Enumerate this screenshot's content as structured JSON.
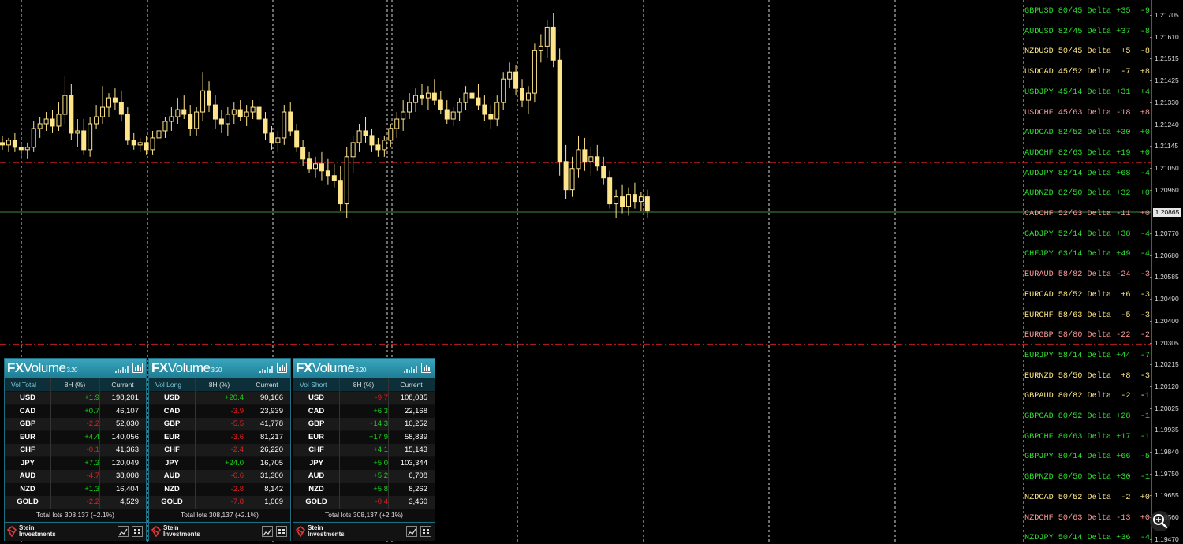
{
  "colors": {
    "green": "#2ee02e",
    "red": "#ff9a9a",
    "yellow": "#ffe680",
    "candle": "#ffe58a",
    "grid": "#ffffff",
    "level_line": "#c02020",
    "current_line": "#3f8a3f",
    "panel_header": "#2a94ab"
  },
  "pairs": [
    {
      "text": "GBPUSD 80/45 Delta +35  -9",
      "color": "green"
    },
    {
      "text": "AUDUSD 82/45 Delta +37  -8",
      "color": "green"
    },
    {
      "text": "NZDUSD 50/45 Delta  +5  -8",
      "color": "yellow"
    },
    {
      "text": "USDCAD 45/52 Delta  -7  +8",
      "color": "yellow"
    },
    {
      "text": "USDJPY 45/14 Delta +31  +4",
      "color": "green"
    },
    {
      "text": "USDCHF 45/63 Delta -18  +8",
      "color": "red"
    },
    {
      "text": "AUDCAD 82/52 Delta +30  +0",
      "color": "green"
    },
    {
      "text": "AUDCHF 82/63 Delta +19  +0",
      "color": "green"
    },
    {
      "text": "AUDJPY 82/14 Delta +68  -4",
      "color": "green"
    },
    {
      "text": "AUDNZD 82/50 Delta +32  +0",
      "color": "green"
    },
    {
      "text": "CADCHF 52/63 Delta -11  +0",
      "color": "red"
    },
    {
      "text": "CADJPY 52/14 Delta +38  -4",
      "color": "green"
    },
    {
      "text": "CHFJPY 63/14 Delta +49  -4",
      "color": "green"
    },
    {
      "text": "EURAUD 58/82 Delta -24  -3",
      "color": "red"
    },
    {
      "text": "EURCAD 58/52 Delta  +6  -3",
      "color": "yellow"
    },
    {
      "text": "EURCHF 58/63 Delta  -5  -3",
      "color": "yellow"
    },
    {
      "text": "EURGBP 58/80 Delta -22  -2",
      "color": "red"
    },
    {
      "text": "EURJPY 58/14 Delta +44  -7",
      "color": "green"
    },
    {
      "text": "EURNZD 58/50 Delta  +8  -3",
      "color": "yellow"
    },
    {
      "text": "GBPAUD 80/82 Delta  -2  -1",
      "color": "yellow"
    },
    {
      "text": "GBPCAD 80/52 Delta +28  -1",
      "color": "green"
    },
    {
      "text": "GBPCHF 80/63 Delta +17  -1",
      "color": "green"
    },
    {
      "text": "GBPJPY 80/14 Delta +66  -5",
      "color": "green"
    },
    {
      "text": "GBPNZD 80/50 Delta +30  -1",
      "color": "green"
    },
    {
      "text": "NZDCAD 50/52 Delta  -2  +0",
      "color": "yellow"
    },
    {
      "text": "NZDCHF 50/63 Delta -13  +0",
      "color": "red"
    },
    {
      "text": "NZDJPY 50/14 Delta +36  -4",
      "color": "green"
    }
  ],
  "price_axis": {
    "labels": [
      "1.21705",
      "1.21610",
      "1.21515",
      "1.21425",
      "1.21330",
      "1.21240",
      "1.21145",
      "1.21050",
      "1.20960",
      "1.20865",
      "1.20770",
      "1.20680",
      "1.20585",
      "1.20490",
      "1.20400",
      "1.20305",
      "1.20215",
      "1.20120",
      "1.20025",
      "1.19935",
      "1.19840",
      "1.19750",
      "1.19655",
      "1.19560",
      "1.19470"
    ],
    "current": "1.20865"
  },
  "chart": {
    "price_top": 1.21705,
    "price_bottom": 1.1947,
    "current_price": 1.20865,
    "level_upper": 1.21075,
    "level_lower": 1.20305,
    "candles": [
      [
        1.2116,
        1.2119,
        1.2113,
        1.2115
      ],
      [
        1.2115,
        1.2118,
        1.2112,
        1.2117
      ],
      [
        1.2117,
        1.212,
        1.2112,
        1.2114
      ],
      [
        1.2114,
        1.2116,
        1.2109,
        1.2113
      ],
      [
        1.2113,
        1.2116,
        1.2109,
        1.2114
      ],
      [
        1.2114,
        1.2125,
        1.2112,
        1.2122
      ],
      [
        1.2122,
        1.2127,
        1.2118,
        1.2124
      ],
      [
        1.2124,
        1.2129,
        1.2121,
        1.2126
      ],
      [
        1.2126,
        1.213,
        1.212,
        1.2123
      ],
      [
        1.2123,
        1.2133,
        1.2121,
        1.2128
      ],
      [
        1.2128,
        1.2144,
        1.2124,
        1.2136
      ],
      [
        1.2136,
        1.2141,
        1.2117,
        1.212
      ],
      [
        1.212,
        1.2126,
        1.2114,
        1.2121
      ],
      [
        1.2121,
        1.2126,
        1.2111,
        1.2113
      ],
      [
        1.2113,
        1.2127,
        1.211,
        1.2124
      ],
      [
        1.2124,
        1.2132,
        1.2122,
        1.2127
      ],
      [
        1.2127,
        1.214,
        1.2124,
        1.2131
      ],
      [
        1.2131,
        1.2137,
        1.2127,
        1.2135
      ],
      [
        1.2135,
        1.2139,
        1.213,
        1.2133
      ],
      [
        1.2133,
        1.2138,
        1.2125,
        1.2128
      ],
      [
        1.2128,
        1.2131,
        1.2115,
        1.2117
      ],
      [
        1.2117,
        1.212,
        1.2113,
        1.2115
      ],
      [
        1.2115,
        1.2118,
        1.2112,
        1.2116
      ],
      [
        1.2116,
        1.2119,
        1.2111,
        1.2113
      ],
      [
        1.2113,
        1.2121,
        1.2111,
        1.2118
      ],
      [
        1.2118,
        1.2124,
        1.2115,
        1.2121
      ],
      [
        1.2121,
        1.2127,
        1.2118,
        1.2125
      ],
      [
        1.2125,
        1.2131,
        1.2121,
        1.2127
      ],
      [
        1.2127,
        1.2135,
        1.2124,
        1.213
      ],
      [
        1.213,
        1.2136,
        1.2126,
        1.2128
      ],
      [
        1.2128,
        1.2132,
        1.2119,
        1.2122
      ],
      [
        1.2122,
        1.2131,
        1.2119,
        1.2129
      ],
      [
        1.2129,
        1.2146,
        1.2125,
        1.2138
      ],
      [
        1.2138,
        1.2142,
        1.2129,
        1.2132
      ],
      [
        1.2132,
        1.2136,
        1.2122,
        1.2126
      ],
      [
        1.2126,
        1.213,
        1.212,
        1.2124
      ],
      [
        1.2124,
        1.2131,
        1.2119,
        1.2128
      ],
      [
        1.2128,
        1.2133,
        1.2124,
        1.213
      ],
      [
        1.213,
        1.2134,
        1.2125,
        1.2127
      ],
      [
        1.2127,
        1.2132,
        1.2123,
        1.2129
      ],
      [
        1.2129,
        1.2134,
        1.2126,
        1.2131
      ],
      [
        1.2131,
        1.2135,
        1.2124,
        1.2126
      ],
      [
        1.2126,
        1.2129,
        1.2117,
        1.212
      ],
      [
        1.212,
        1.2123,
        1.2113,
        1.2116
      ],
      [
        1.2116,
        1.2121,
        1.2112,
        1.2118
      ],
      [
        1.2118,
        1.2132,
        1.2115,
        1.2129
      ],
      [
        1.2129,
        1.2133,
        1.2119,
        1.2121
      ],
      [
        1.2121,
        1.2124,
        1.2112,
        1.2114
      ],
      [
        1.2114,
        1.2117,
        1.2106,
        1.2109
      ],
      [
        1.2109,
        1.2112,
        1.2103,
        1.2105
      ],
      [
        1.2105,
        1.211,
        1.2101,
        1.2107
      ],
      [
        1.2107,
        1.2112,
        1.21,
        1.2104
      ],
      [
        1.2104,
        1.2109,
        1.2098,
        1.2102
      ],
      [
        1.2102,
        1.2107,
        1.2097,
        1.21
      ],
      [
        1.21,
        1.2106,
        1.2087,
        1.209
      ],
      [
        1.209,
        1.2114,
        1.2084,
        1.211
      ],
      [
        1.211,
        1.2119,
        1.2103,
        1.2116
      ],
      [
        1.2116,
        1.2124,
        1.2112,
        1.2121
      ],
      [
        1.2121,
        1.2127,
        1.2116,
        1.2119
      ],
      [
        1.2119,
        1.2122,
        1.2112,
        1.2115
      ],
      [
        1.2115,
        1.2118,
        1.211,
        1.2113
      ],
      [
        1.2113,
        1.2119,
        1.211,
        1.2117
      ],
      [
        1.2117,
        1.2124,
        1.2114,
        1.2122
      ],
      [
        1.2122,
        1.2129,
        1.2118,
        1.2126
      ],
      [
        1.2126,
        1.2134,
        1.2121,
        1.2129
      ],
      [
        1.2129,
        1.2137,
        1.2126,
        1.2133
      ],
      [
        1.2133,
        1.2139,
        1.2129,
        1.2136
      ],
      [
        1.2136,
        1.2141,
        1.2132,
        1.2135
      ],
      [
        1.2135,
        1.214,
        1.213,
        1.2137
      ],
      [
        1.2137,
        1.2143,
        1.2132,
        1.2134
      ],
      [
        1.2134,
        1.2138,
        1.2128,
        1.213
      ],
      [
        1.213,
        1.2134,
        1.2124,
        1.2126
      ],
      [
        1.2126,
        1.2131,
        1.2123,
        1.2129
      ],
      [
        1.2129,
        1.2135,
        1.2125,
        1.2133
      ],
      [
        1.2133,
        1.214,
        1.213,
        1.2137
      ],
      [
        1.2137,
        1.2143,
        1.2132,
        1.2135
      ],
      [
        1.2135,
        1.2141,
        1.213,
        1.2132
      ],
      [
        1.2132,
        1.2136,
        1.2125,
        1.2128
      ],
      [
        1.2128,
        1.2132,
        1.2122,
        1.2126
      ],
      [
        1.2126,
        1.2136,
        1.2123,
        1.2133
      ],
      [
        1.2133,
        1.2146,
        1.213,
        1.2143
      ],
      [
        1.2143,
        1.215,
        1.2139,
        1.2146
      ],
      [
        1.2146,
        1.2149,
        1.2136,
        1.2139
      ],
      [
        1.2139,
        1.2143,
        1.2131,
        1.2134
      ],
      [
        1.2134,
        1.214,
        1.2128,
        1.2137
      ],
      [
        1.2137,
        1.2158,
        1.2133,
        1.2155
      ],
      [
        1.2155,
        1.2162,
        1.215,
        1.2157
      ],
      [
        1.2157,
        1.2168,
        1.2152,
        1.2165
      ],
      [
        1.2165,
        1.2171,
        1.2148,
        1.2151
      ],
      [
        1.2151,
        1.2156,
        1.2102,
        1.2108
      ],
      [
        1.2108,
        1.2115,
        1.2092,
        1.2096
      ],
      [
        1.2096,
        1.211,
        1.2093,
        1.2105
      ],
      [
        1.2105,
        1.2119,
        1.2101,
        1.2113
      ],
      [
        1.2113,
        1.2118,
        1.2104,
        1.2108
      ],
      [
        1.2108,
        1.2114,
        1.2102,
        1.211
      ],
      [
        1.211,
        1.2115,
        1.2104,
        1.2106
      ],
      [
        1.2106,
        1.211,
        1.2098,
        1.2101
      ],
      [
        1.2101,
        1.2104,
        1.2088,
        1.209
      ],
      [
        1.209,
        1.2096,
        1.2084,
        1.2093
      ],
      [
        1.2093,
        1.2098,
        1.2086,
        1.2089
      ],
      [
        1.2089,
        1.2097,
        1.2085,
        1.2094
      ],
      [
        1.2094,
        1.2099,
        1.2088,
        1.2091
      ],
      [
        1.2091,
        1.2095,
        1.2087,
        1.2093
      ],
      [
        1.2093,
        1.2096,
        1.2084,
        1.2087
      ]
    ]
  },
  "panels": [
    {
      "logo_fx": "FX",
      "logo_volume": "Volume",
      "version": "3.20",
      "col1": "Vol Total",
      "col2": "8H (%)",
      "col3": "Current",
      "rows": [
        {
          "cur": "USD",
          "pct": "+1.9",
          "val": "198,201"
        },
        {
          "cur": "CAD",
          "pct": "+0.7",
          "val": "46,107"
        },
        {
          "cur": "GBP",
          "pct": "-2.2",
          "val": "52,030"
        },
        {
          "cur": "EUR",
          "pct": "+4.4",
          "val": "140,056"
        },
        {
          "cur": "CHF",
          "pct": "-0.1",
          "val": "41,363"
        },
        {
          "cur": "JPY",
          "pct": "+7.3",
          "val": "120,049"
        },
        {
          "cur": "AUD",
          "pct": "-4.7",
          "val": "38,008"
        },
        {
          "cur": "NZD",
          "pct": "+1.3",
          "val": "16,404"
        },
        {
          "cur": "GOLD",
          "pct": "-2.2",
          "val": "4,529"
        }
      ],
      "total": "Total lots 308,137 (+2.1%)",
      "brand_line1": "Stein",
      "brand_line2": "Investments"
    },
    {
      "logo_fx": "FX",
      "logo_volume": "Volume",
      "version": "3.20",
      "col1": "Vol Long",
      "col2": "8H (%)",
      "col3": "Current",
      "rows": [
        {
          "cur": "USD",
          "pct": "+20.4",
          "val": "90,166"
        },
        {
          "cur": "CAD",
          "pct": "-3.9",
          "val": "23,939"
        },
        {
          "cur": "GBP",
          "pct": "-5.5",
          "val": "41,778"
        },
        {
          "cur": "EUR",
          "pct": "-3.6",
          "val": "81,217"
        },
        {
          "cur": "CHF",
          "pct": "-2.4",
          "val": "26,220"
        },
        {
          "cur": "JPY",
          "pct": "+24.0",
          "val": "16,705"
        },
        {
          "cur": "AUD",
          "pct": "-6.6",
          "val": "31,300"
        },
        {
          "cur": "NZD",
          "pct": "-2.8",
          "val": "8,142"
        },
        {
          "cur": "GOLD",
          "pct": "-7.8",
          "val": "1,069"
        }
      ],
      "total": "Total lots 308,137 (+2.1%)",
      "brand_line1": "Stein",
      "brand_line2": "Investments"
    },
    {
      "logo_fx": "FX",
      "logo_volume": "Volume",
      "version": "3.20",
      "col1": "Vol Short",
      "col2": "8H (%)",
      "col3": "Current",
      "rows": [
        {
          "cur": "USD",
          "pct": "-9.7",
          "val": "108,035"
        },
        {
          "cur": "CAD",
          "pct": "+6.3",
          "val": "22,168"
        },
        {
          "cur": "GBP",
          "pct": "+14.3",
          "val": "10,252"
        },
        {
          "cur": "EUR",
          "pct": "+17.9",
          "val": "58,839"
        },
        {
          "cur": "CHF",
          "pct": "+4.1",
          "val": "15,143"
        },
        {
          "cur": "JPY",
          "pct": "+5.0",
          "val": "103,344"
        },
        {
          "cur": "AUD",
          "pct": "+5.2",
          "val": "6,708"
        },
        {
          "cur": "NZD",
          "pct": "+5.8",
          "val": "8,262"
        },
        {
          "cur": "GOLD",
          "pct": "-0.4",
          "val": "3,460"
        }
      ],
      "total": "Total lots 308,137 (+2.1%)",
      "brand_line1": "Stein",
      "brand_line2": "Investments"
    }
  ],
  "icons": {
    "zoom": "zoom-icon",
    "chart_button": "bar-chart-icon",
    "line_button": "line-chart-icon",
    "grid_button": "grid-list-icon",
    "logo": "stein-logo-icon"
  }
}
